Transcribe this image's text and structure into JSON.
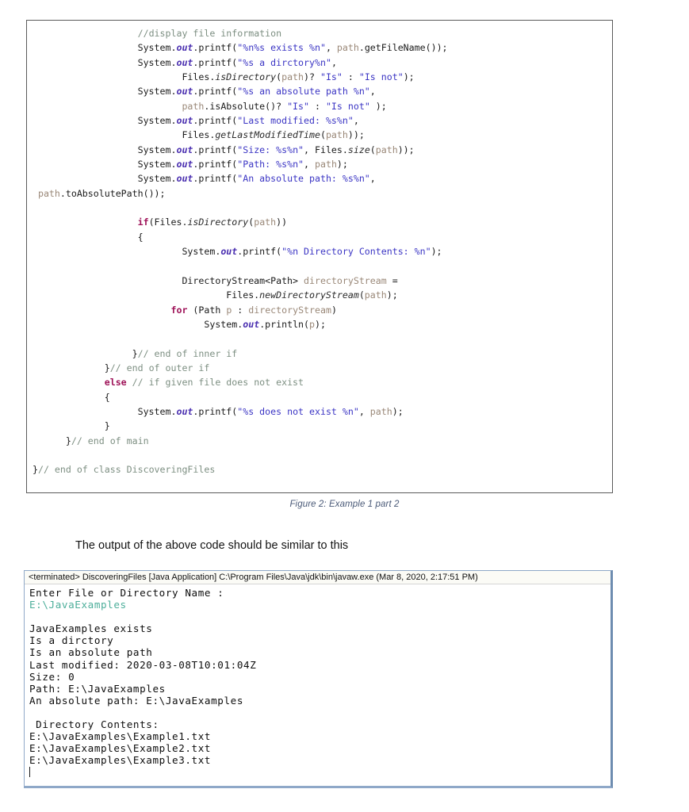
{
  "code_figure": {
    "language": "java",
    "lines": [
      [
        {
          "t": "                    ",
          "c": "pl"
        },
        {
          "t": "//display file information",
          "c": "cm"
        }
      ],
      [
        {
          "t": "                    System.",
          "c": "pl"
        },
        {
          "t": "out",
          "c": "fld"
        },
        {
          "t": ".printf(",
          "c": "pl"
        },
        {
          "t": "\"%n%s exists %n\"",
          "c": "st"
        },
        {
          "t": ", ",
          "c": "pl"
        },
        {
          "t": "path",
          "c": "var"
        },
        {
          "t": ".getFileName());",
          "c": "pl"
        }
      ],
      [
        {
          "t": "                    System.",
          "c": "pl"
        },
        {
          "t": "out",
          "c": "fld"
        },
        {
          "t": ".printf(",
          "c": "pl"
        },
        {
          "t": "\"%s a dirctory%n\"",
          "c": "st"
        },
        {
          "t": ",",
          "c": "pl"
        }
      ],
      [
        {
          "t": "                            Files.",
          "c": "pl"
        },
        {
          "t": "isDirectory",
          "c": "mth"
        },
        {
          "t": "(",
          "c": "pl"
        },
        {
          "t": "path",
          "c": "var"
        },
        {
          "t": ")? ",
          "c": "pl"
        },
        {
          "t": "\"Is\"",
          "c": "st"
        },
        {
          "t": " : ",
          "c": "pl"
        },
        {
          "t": "\"Is not\"",
          "c": "st"
        },
        {
          "t": ");",
          "c": "pl"
        }
      ],
      [
        {
          "t": "                    System.",
          "c": "pl"
        },
        {
          "t": "out",
          "c": "fld"
        },
        {
          "t": ".printf(",
          "c": "pl"
        },
        {
          "t": "\"%s an absolute path %n\"",
          "c": "st"
        },
        {
          "t": ",",
          "c": "pl"
        }
      ],
      [
        {
          "t": "                            ",
          "c": "pl"
        },
        {
          "t": "path",
          "c": "var"
        },
        {
          "t": ".isAbsolute()? ",
          "c": "pl"
        },
        {
          "t": "\"Is\"",
          "c": "st"
        },
        {
          "t": " : ",
          "c": "pl"
        },
        {
          "t": "\"Is not\"",
          "c": "st"
        },
        {
          "t": " );",
          "c": "pl"
        }
      ],
      [
        {
          "t": "                    System.",
          "c": "pl"
        },
        {
          "t": "out",
          "c": "fld"
        },
        {
          "t": ".printf(",
          "c": "pl"
        },
        {
          "t": "\"Last modified: %s%n\"",
          "c": "st"
        },
        {
          "t": ",",
          "c": "pl"
        }
      ],
      [
        {
          "t": "                            Files.",
          "c": "pl"
        },
        {
          "t": "getLastModifiedTime",
          "c": "mth"
        },
        {
          "t": "(",
          "c": "pl"
        },
        {
          "t": "path",
          "c": "var"
        },
        {
          "t": "));",
          "c": "pl"
        }
      ],
      [
        {
          "t": "                    System.",
          "c": "pl"
        },
        {
          "t": "out",
          "c": "fld"
        },
        {
          "t": ".printf(",
          "c": "pl"
        },
        {
          "t": "\"Size: %s%n\"",
          "c": "st"
        },
        {
          "t": ", Files.",
          "c": "pl"
        },
        {
          "t": "size",
          "c": "mth"
        },
        {
          "t": "(",
          "c": "pl"
        },
        {
          "t": "path",
          "c": "var"
        },
        {
          "t": "));",
          "c": "pl"
        }
      ],
      [
        {
          "t": "                    System.",
          "c": "pl"
        },
        {
          "t": "out",
          "c": "fld"
        },
        {
          "t": ".printf(",
          "c": "pl"
        },
        {
          "t": "\"Path: %s%n\"",
          "c": "st"
        },
        {
          "t": ", ",
          "c": "pl"
        },
        {
          "t": "path",
          "c": "var"
        },
        {
          "t": ");",
          "c": "pl"
        }
      ],
      [
        {
          "t": "                    System.",
          "c": "pl"
        },
        {
          "t": "out",
          "c": "fld"
        },
        {
          "t": ".printf(",
          "c": "pl"
        },
        {
          "t": "\"An absolute path: %s%n\"",
          "c": "st"
        },
        {
          "t": ",",
          "c": "pl"
        }
      ],
      [
        {
          "t": "  ",
          "c": "pl"
        },
        {
          "t": "path",
          "c": "var"
        },
        {
          "t": ".toAbsolutePath());",
          "c": "pl"
        }
      ],
      [
        {
          "t": "",
          "c": "pl"
        }
      ],
      [
        {
          "t": "                    ",
          "c": "pl"
        },
        {
          "t": "if",
          "c": "kw"
        },
        {
          "t": "(Files.",
          "c": "pl"
        },
        {
          "t": "isDirectory",
          "c": "mth"
        },
        {
          "t": "(",
          "c": "pl"
        },
        {
          "t": "path",
          "c": "var"
        },
        {
          "t": "))",
          "c": "pl"
        }
      ],
      [
        {
          "t": "                    {",
          "c": "pl"
        }
      ],
      [
        {
          "t": "                            System.",
          "c": "pl"
        },
        {
          "t": "out",
          "c": "fld"
        },
        {
          "t": ".printf(",
          "c": "pl"
        },
        {
          "t": "\"%n Directory Contents: %n\"",
          "c": "st"
        },
        {
          "t": ");",
          "c": "pl"
        }
      ],
      [
        {
          "t": "",
          "c": "pl"
        }
      ],
      [
        {
          "t": "                            DirectoryStream<Path> ",
          "c": "pl"
        },
        {
          "t": "directoryStream",
          "c": "var"
        },
        {
          "t": " =",
          "c": "pl"
        }
      ],
      [
        {
          "t": "                                    Files.",
          "c": "pl"
        },
        {
          "t": "newDirectoryStream",
          "c": "mth"
        },
        {
          "t": "(",
          "c": "pl"
        },
        {
          "t": "path",
          "c": "var"
        },
        {
          "t": ");",
          "c": "pl"
        }
      ],
      [
        {
          "t": "                          ",
          "c": "pl"
        },
        {
          "t": "for",
          "c": "kw"
        },
        {
          "t": " (Path ",
          "c": "pl"
        },
        {
          "t": "p",
          "c": "var"
        },
        {
          "t": " : ",
          "c": "pl"
        },
        {
          "t": "directoryStream",
          "c": "var"
        },
        {
          "t": ")",
          "c": "pl"
        }
      ],
      [
        {
          "t": "                                System.",
          "c": "pl"
        },
        {
          "t": "out",
          "c": "fld"
        },
        {
          "t": ".println(",
          "c": "pl"
        },
        {
          "t": "p",
          "c": "var"
        },
        {
          "t": ");",
          "c": "pl"
        }
      ],
      [
        {
          "t": "",
          "c": "pl"
        }
      ],
      [
        {
          "t": "                   }",
          "c": "pl"
        },
        {
          "t": "// end of inner if",
          "c": "cm"
        }
      ],
      [
        {
          "t": "              }",
          "c": "pl"
        },
        {
          "t": "// end of outer if",
          "c": "cm"
        }
      ],
      [
        {
          "t": "              ",
          "c": "pl"
        },
        {
          "t": "else",
          "c": "kw"
        },
        {
          "t": " ",
          "c": "pl"
        },
        {
          "t": "// if given file does not exist",
          "c": "cm"
        }
      ],
      [
        {
          "t": "              {",
          "c": "pl"
        }
      ],
      [
        {
          "t": "                    System.",
          "c": "pl"
        },
        {
          "t": "out",
          "c": "fld"
        },
        {
          "t": ".printf(",
          "c": "pl"
        },
        {
          "t": "\"%s does not exist %n\"",
          "c": "st"
        },
        {
          "t": ", ",
          "c": "pl"
        },
        {
          "t": "path",
          "c": "var"
        },
        {
          "t": ");",
          "c": "pl"
        }
      ],
      [
        {
          "t": "              }",
          "c": "pl"
        }
      ],
      [
        {
          "t": "       }",
          "c": "pl"
        },
        {
          "t": "// end of main",
          "c": "cm"
        }
      ],
      [
        {
          "t": "",
          "c": "pl"
        }
      ],
      [
        {
          "t": " }",
          "c": "pl"
        },
        {
          "t": "// end of class DiscoveringFiles",
          "c": "cm"
        }
      ]
    ],
    "colors": {
      "comment": "#7d8f82",
      "string": "#3b35c4",
      "keyword": "#9e1157",
      "static_field": "#4a2fb0",
      "static_method": "#2b2b2b",
      "variable": "#9a8878",
      "plain": "#1a1a1a",
      "border": "#5a5a5a"
    }
  },
  "figure_caption": "Figure 2: Example 1 part 2",
  "body_text": "The output of the above code should be similar to this",
  "console": {
    "title": "<terminated> DiscoveringFiles [Java Application] C:\\Program Files\\Java\\jdk\\bin\\javaw.exe (Mar 8, 2020, 2:17:51 PM)",
    "border_color": "#8fa8c8",
    "input_color": "#4cae9a",
    "lines": [
      {
        "text": "Enter File or Directory Name :",
        "kind": "output"
      },
      {
        "text": "E:\\JavaExamples",
        "kind": "input"
      },
      {
        "text": "",
        "kind": "output"
      },
      {
        "text": "JavaExamples exists",
        "kind": "output"
      },
      {
        "text": "Is a dirctory",
        "kind": "output"
      },
      {
        "text": "Is an absolute path",
        "kind": "output"
      },
      {
        "text": "Last modified: 2020-03-08T10:01:04Z",
        "kind": "output"
      },
      {
        "text": "Size: 0",
        "kind": "output"
      },
      {
        "text": "Path: E:\\JavaExamples",
        "kind": "output"
      },
      {
        "text": "An absolute path: E:\\JavaExamples",
        "kind": "output"
      },
      {
        "text": "",
        "kind": "output"
      },
      {
        "text": " Directory Contents:",
        "kind": "output"
      },
      {
        "text": "E:\\JavaExamples\\Example1.txt",
        "kind": "output"
      },
      {
        "text": "E:\\JavaExamples\\Example2.txt",
        "kind": "output"
      },
      {
        "text": "E:\\JavaExamples\\Example3.txt",
        "kind": "output"
      }
    ]
  }
}
